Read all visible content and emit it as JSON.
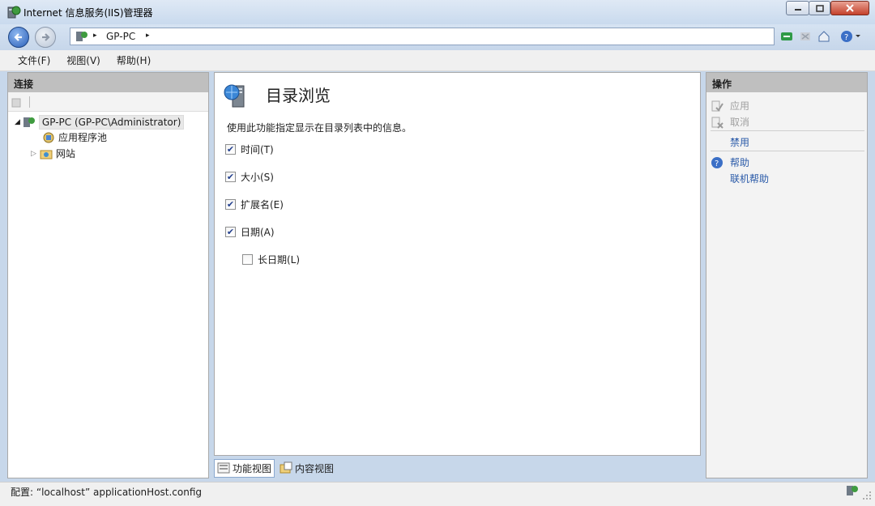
{
  "window": {
    "title": "Internet 信息服务(IIS)管理器"
  },
  "address": {
    "path": "GP-PC",
    "separator": "▸"
  },
  "menu": {
    "items": [
      "文件(F)",
      "视图(V)",
      "帮助(H)"
    ]
  },
  "left": {
    "header": "连接",
    "tree": {
      "root": "GP-PC (GP-PC\\Administrator)",
      "children": [
        "应用程序池",
        "网站"
      ]
    }
  },
  "center": {
    "title": "目录浏览",
    "description": "使用此功能指定显示在目录列表中的信息。",
    "options": [
      {
        "label": "时间(T)",
        "checked": true
      },
      {
        "label": "大小(S)",
        "checked": true
      },
      {
        "label": "扩展名(E)",
        "checked": true
      },
      {
        "label": "日期(A)",
        "checked": true
      },
      {
        "label": "长日期(L)",
        "checked": false
      }
    ]
  },
  "tabs": {
    "feature_view": "功能视图",
    "content_view": "内容视图"
  },
  "actions": {
    "header": "操作",
    "apply": "应用",
    "cancel": "取消",
    "disable": "禁用",
    "help": "帮助",
    "online_help": "联机帮助"
  },
  "status": {
    "text": "配置: “localhost”  applicationHost.config"
  },
  "colors": {
    "link": "#2a5aa8",
    "disabled": "#a0a0a0",
    "panel_header": "#bfbfbf"
  }
}
